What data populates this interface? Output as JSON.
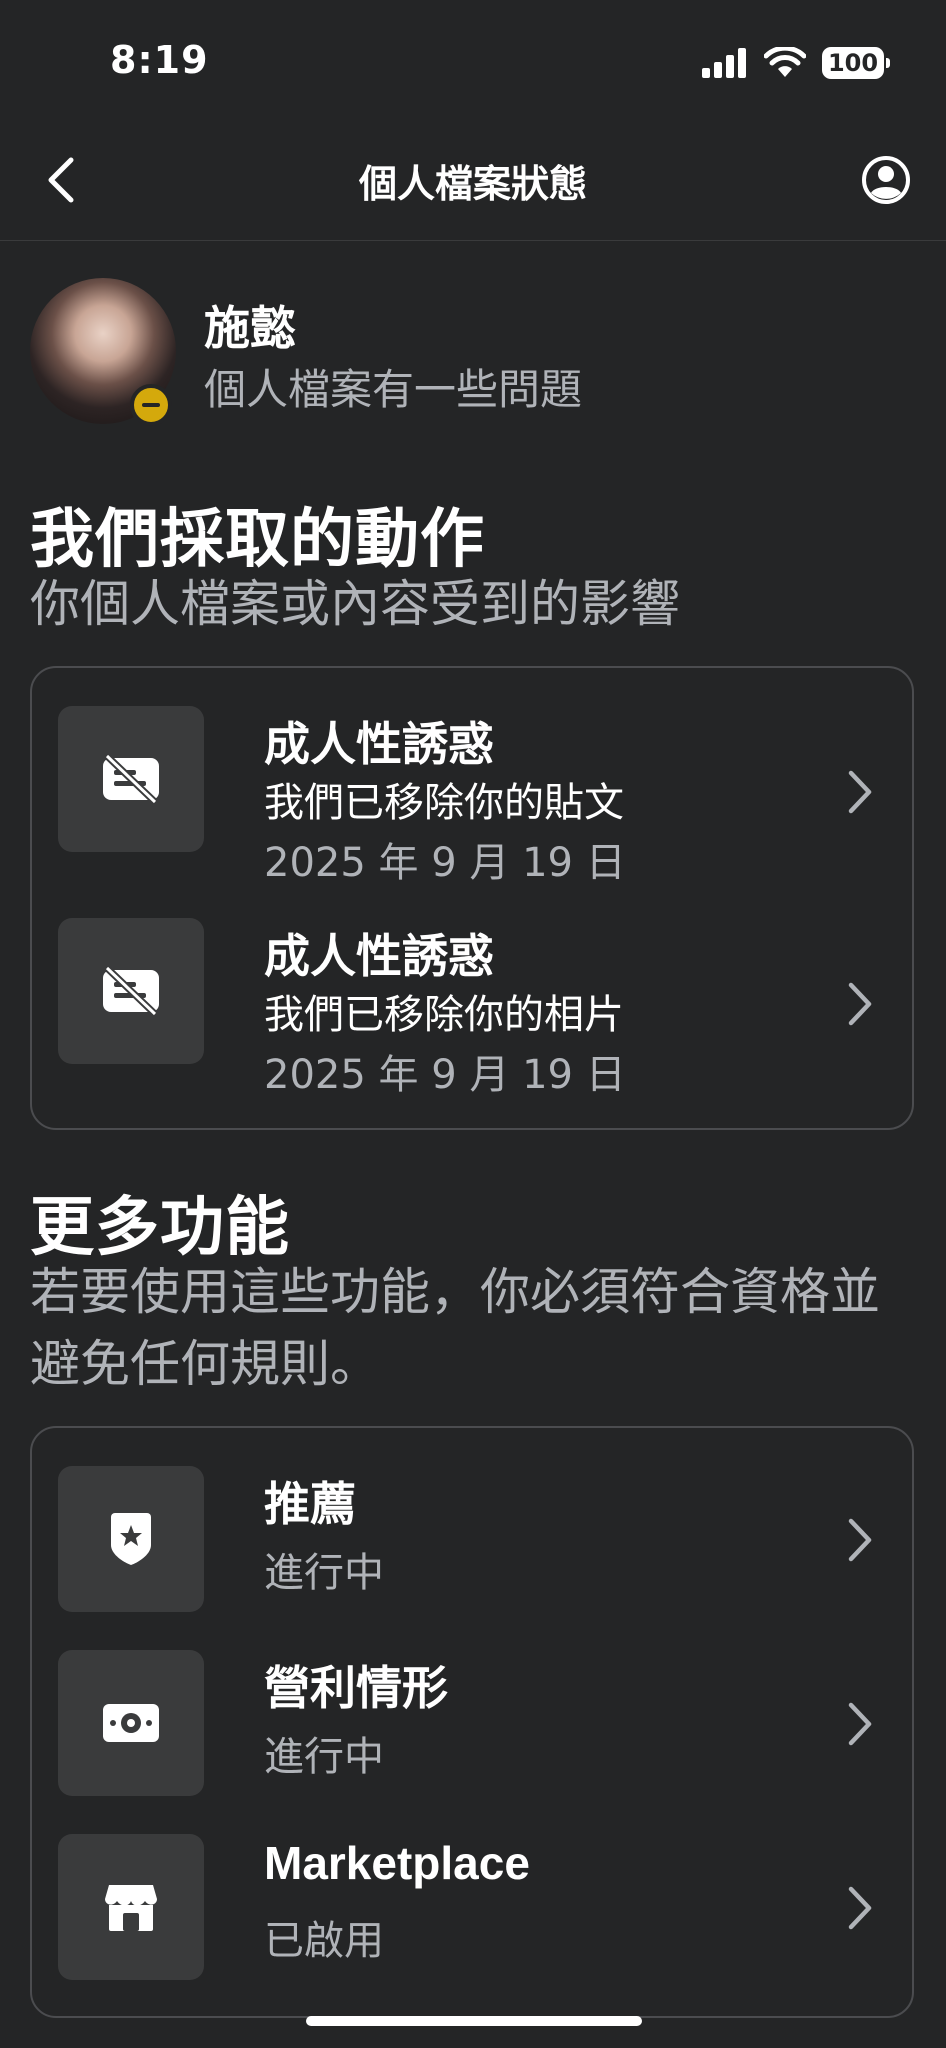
{
  "status_bar": {
    "time": "8:19",
    "battery": "100"
  },
  "nav": {
    "title": "個人檔案狀態"
  },
  "profile": {
    "name": "施懿",
    "status": "個人檔案有一些問題",
    "badge_color": "#d4a90c"
  },
  "actions_section": {
    "title": "我們採取的動作",
    "subtitle": "你個人檔案或內容受到的影響",
    "items": [
      {
        "title": "成人性誘惑",
        "description": "我們已移除你的貼文",
        "date": "2025 年 9 月 19 日",
        "icon": "removed-content-icon"
      },
      {
        "title": "成人性誘惑",
        "description": "我們已移除你的相片",
        "date": "2025 年 9 月 19 日",
        "icon": "removed-content-icon"
      }
    ]
  },
  "features_section": {
    "title": "更多功能",
    "subtitle": "若要使用這些功能，你必須符合資格並避免任何規則。",
    "items": [
      {
        "title": "推薦",
        "status": "進行中",
        "icon": "recommendation-shield-icon"
      },
      {
        "title": "營利情形",
        "status": "進行中",
        "icon": "monetization-money-icon"
      },
      {
        "title": "Marketplace",
        "status": "已啟用",
        "icon": "marketplace-shop-icon"
      }
    ]
  },
  "colors": {
    "background": "#242526",
    "secondary_text": "#b0b3b8",
    "tile": "#3a3b3c",
    "card_border": "#4b4c4f"
  }
}
